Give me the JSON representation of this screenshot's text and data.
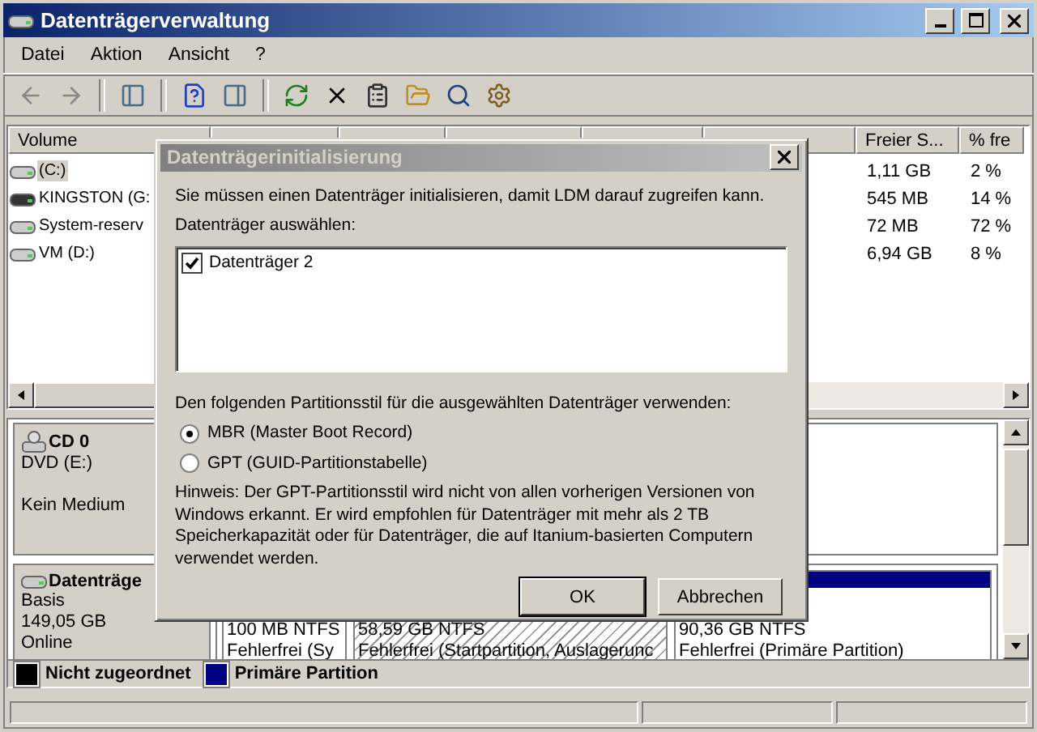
{
  "window": {
    "title": "Datenträgerverwaltung"
  },
  "menu": [
    "Datei",
    "Aktion",
    "Ansicht",
    "?"
  ],
  "toolbar": [
    {
      "kind": "back"
    },
    {
      "kind": "forward"
    },
    {
      "kind": "sep"
    },
    {
      "kind": "tree"
    },
    {
      "kind": "sep"
    },
    {
      "kind": "help"
    },
    {
      "kind": "pane"
    },
    {
      "kind": "sep"
    },
    {
      "kind": "refresh"
    },
    {
      "kind": "delete"
    },
    {
      "kind": "properties"
    },
    {
      "kind": "open"
    },
    {
      "kind": "search"
    },
    {
      "kind": "settings"
    }
  ],
  "volume_list": {
    "columns": [
      {
        "kind": "text",
        "label": "Volume"
      },
      {
        "kind": "covered"
      },
      {
        "kind": "covered"
      },
      {
        "kind": "covered"
      },
      {
        "kind": "covered"
      },
      {
        "kind": "covered"
      },
      {
        "kind": "text",
        "label": "Freier S..."
      },
      {
        "kind": "text",
        "label": "% fre"
      }
    ],
    "rows": [
      {
        "kind": "fixed",
        "name": "(C:)",
        "free": "1,11 GB",
        "percent": "2 %",
        "selected": true
      },
      {
        "kind": "usb",
        "name": "KINGSTON (G:",
        "free": "545 MB",
        "percent": "14 %",
        "selected": false
      },
      {
        "kind": "fixed",
        "name": "System-reserv",
        "free": "72 MB",
        "percent": "72 %",
        "selected": false
      },
      {
        "kind": "fixed",
        "name": "VM (D:)",
        "free": "6,94 GB",
        "percent": "8 %",
        "selected": false
      }
    ]
  },
  "disks": [
    {
      "kind": "cdrom",
      "name": "CD 0",
      "lines": [
        "DVD (E:)",
        "Kein Medium"
      ]
    },
    {
      "kind": "disk",
      "name": "Datenträge",
      "lines": [
        "Basis",
        "149,05 GB",
        "Online"
      ],
      "partitions": [
        {
          "size": "100 MB NTFS",
          "status": "Fehlerfrei (Sy",
          "selected": false
        },
        {
          "size": "58,59 GB NTFS",
          "status": "Fehlerfrei (Startpartition, Auslagerunc",
          "selected": true
        },
        {
          "size": "90,36 GB NTFS",
          "status": "Fehlerfrei (Primäre Partition)",
          "selected": false
        }
      ]
    }
  ],
  "legend": [
    {
      "label": "Nicht zugeordnet",
      "color": "#000000"
    },
    {
      "label": "Primäre Partition",
      "color": "#000080"
    }
  ],
  "dialog": {
    "title": "Datenträgerinitialisierung",
    "message": "Sie müssen einen Datenträger initialisieren, damit LDM darauf zugreifen kann.",
    "select_label": "Datenträger auswählen:",
    "disks": [
      {
        "label": "Datenträger 2",
        "checked": true
      }
    ],
    "style_label": "Den folgenden Partitionsstil für die ausgewählten Datenträger verwenden:",
    "styles": [
      {
        "label": "MBR (Master Boot Record)",
        "selected": true
      },
      {
        "label": "GPT (GUID-Partitionstabelle)",
        "selected": false
      }
    ],
    "hint": "Hinweis: Der GPT-Partitionsstil wird nicht von allen vorherigen Versionen von Windows erkannt. Er wird empfohlen für Datenträger mit mehr als 2 TB Speicherkapazität oder für Datenträger, die auf Itanium-basierten Computern verwendet werden.",
    "buttons": [
      {
        "label": "OK",
        "kind": "default"
      },
      {
        "label": "Abbrechen",
        "kind": "normal"
      }
    ]
  }
}
